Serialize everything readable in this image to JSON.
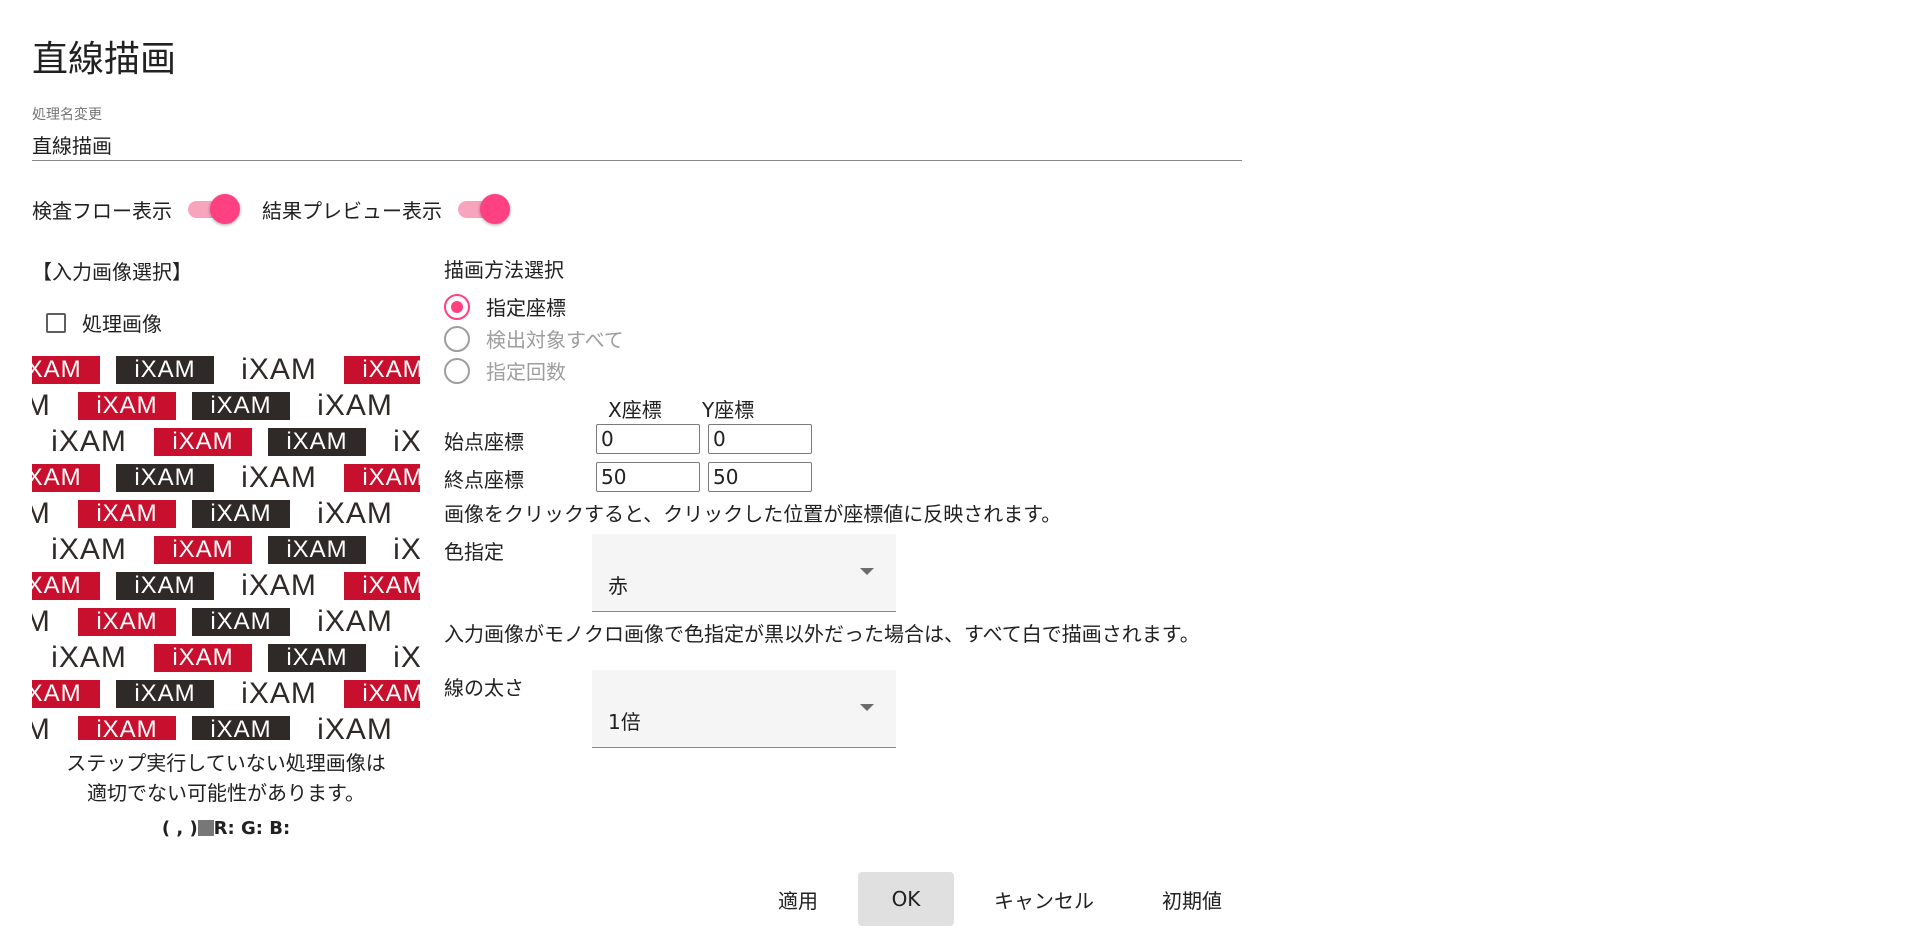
{
  "dialog": {
    "title": "直線描画"
  },
  "name_field": {
    "label": "処理名変更",
    "value": "直線描画"
  },
  "toggles": [
    {
      "label": "検査フロー表示",
      "on": true
    },
    {
      "label": "結果プレビュー表示",
      "on": true
    }
  ],
  "input_select": {
    "title": "【入力画像選択】",
    "checkbox_label": "処理画像",
    "checked": false,
    "logo_text": "iXAM",
    "warning_line1": "ステップ実行していない処理画像は",
    "warning_line2": "適切でない可能性があります。",
    "pixel_info": {
      "coords": "( , )",
      "rgb": "R: G: B:"
    }
  },
  "draw_method": {
    "title": "描画方法選択",
    "options": [
      {
        "label": "指定座標",
        "selected": true
      },
      {
        "label": "検出対象すべて",
        "selected": false
      },
      {
        "label": "指定回数",
        "selected": false
      }
    ]
  },
  "coordinates": {
    "x_header": "X座標",
    "y_header": "Y座標",
    "start": {
      "label": "始点座標",
      "x": "0",
      "y": "0"
    },
    "end": {
      "label": "終点座標",
      "x": "50",
      "y": "50"
    },
    "hint": "画像をクリックすると、クリックした位置が座標値に反映されます。"
  },
  "color": {
    "label": "色指定",
    "value": "赤",
    "note": "入力画像がモノクロ画像で色指定が黒以外だった場合は、すべて白で描画されます。"
  },
  "line_width": {
    "label": "線の太さ",
    "value": "1倍"
  },
  "buttons": {
    "apply": "適用",
    "ok": "OK",
    "cancel": "キャンセル",
    "reset": "初期値"
  },
  "colors": {
    "accent": "#ff4081",
    "accent_track": "#f8a4bf",
    "logo_red": "#c8102e",
    "logo_dark": "#2f2a28"
  }
}
